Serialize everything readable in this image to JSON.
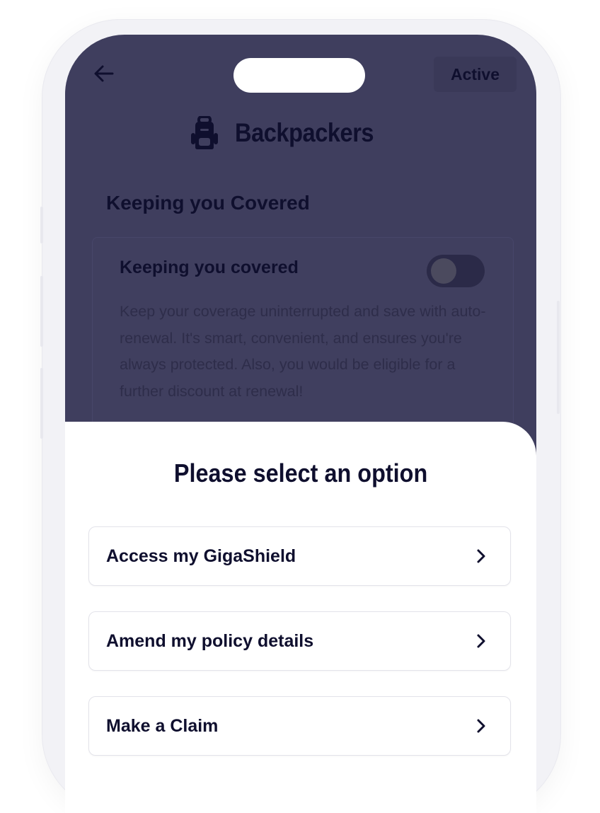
{
  "header": {
    "status_badge": "Active",
    "product_name": "Backpackers",
    "icons": {
      "back": "arrow-left-icon",
      "product": "backpack-icon"
    }
  },
  "section": {
    "heading": "Keeping you Covered",
    "card": {
      "title": "Keeping you covered",
      "toggle_on": false,
      "description": "Keep your coverage uninterrupted and save with auto-renewal. It's smart, convenient, and ensures you're always protected. Also, you would be eligible for a further discount at renewal!"
    }
  },
  "sheet": {
    "title": "Please select an option",
    "options": [
      {
        "label": "Access my GigaShield"
      },
      {
        "label": "Amend my policy details"
      },
      {
        "label": "Make a Claim"
      }
    ]
  },
  "colors": {
    "overlay_background": "#3f3e5e",
    "text_dark": "#0f0f2e",
    "sheet_background": "#ffffff"
  }
}
